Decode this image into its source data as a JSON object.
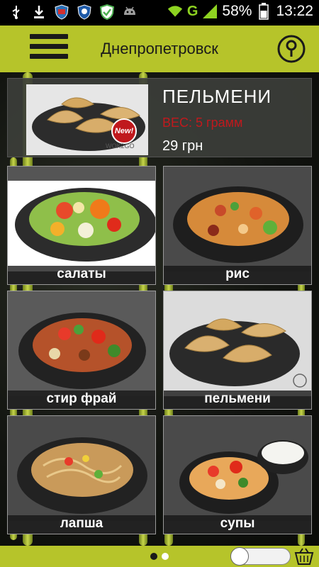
{
  "status_bar": {
    "battery": "58%",
    "time": "13:22",
    "network": "G"
  },
  "header": {
    "city": "Днепропетровск"
  },
  "featured": {
    "title": "ПЕЛЬМЕНИ",
    "weight": "ВЕС: 5 грамм",
    "price": "29 грн",
    "badge": "New!",
    "logo": "WOK2GO"
  },
  "categories": [
    {
      "label": "салаты"
    },
    {
      "label": "рис"
    },
    {
      "label": "стир фрай"
    },
    {
      "label": "пельмени"
    },
    {
      "label": "лапша"
    },
    {
      "label": "супы"
    }
  ],
  "pager": {
    "pages": 2,
    "current": 2
  },
  "colors": {
    "accent": "#b6c42a",
    "price_red": "#c0191d"
  }
}
